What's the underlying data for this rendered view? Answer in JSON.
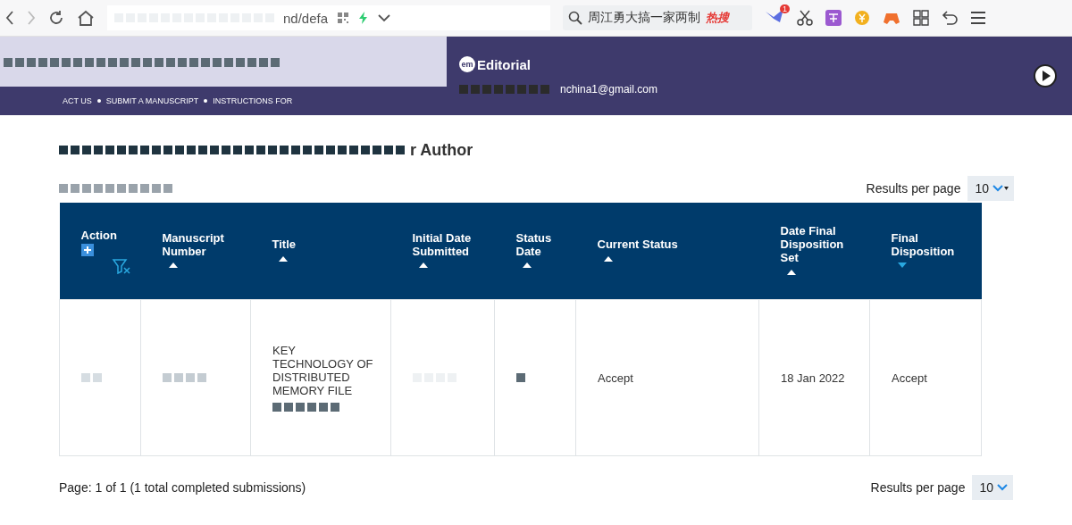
{
  "browser": {
    "url_fragment": "nd/defa",
    "search_text": "周江勇大搞一家两制",
    "hot_badge": "热搜",
    "notification_count": "1"
  },
  "header": {
    "logo_mark": "em",
    "logo_text": "Editorial",
    "user_email": "nchina1@gmail.com",
    "nav_links": [
      "ACT US",
      "SUBMIT A MANUSCRIPT",
      "INSTRUCTIONS FOR"
    ]
  },
  "page_title": "r Author",
  "results_per_page": {
    "label": "Results per page",
    "value": "10"
  },
  "table": {
    "columns": [
      {
        "label": "Action",
        "kind": "action",
        "sortable": false
      },
      {
        "label": "Manuscript Number",
        "kind": "text",
        "sortable": true,
        "selected": false
      },
      {
        "label": "Title",
        "kind": "text",
        "sortable": true,
        "selected": false
      },
      {
        "label": "Initial Date Submitted",
        "kind": "text",
        "sortable": true,
        "selected": false
      },
      {
        "label": "Status Date",
        "kind": "text",
        "sortable": true,
        "selected": false
      },
      {
        "label": "Current Status",
        "kind": "text",
        "sortable": true,
        "selected": false
      },
      {
        "label": "Date Final Disposition Set",
        "kind": "text",
        "sortable": true,
        "selected": false
      },
      {
        "label": "Final Disposition",
        "kind": "text",
        "sortable": true,
        "selected": true
      }
    ],
    "rows": [
      {
        "title": "KEY TECHNOLOGY OF DISTRIBUTED MEMORY FILE",
        "current_status": "Accept",
        "date_final_disposition_set": "18 Jan 2022",
        "final_disposition": "Accept"
      }
    ]
  },
  "footer": {
    "page_info": "Page: 1 of 1 (1 total completed submissions)",
    "results_per_page": {
      "label": "Results per page",
      "value": "10"
    }
  }
}
